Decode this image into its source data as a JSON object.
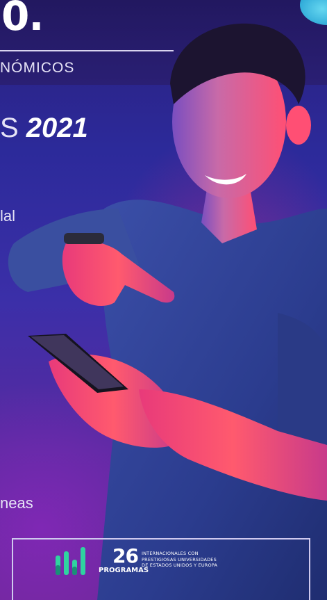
{
  "header": {
    "big_title": "0.",
    "subtitle": "NÓMICOS"
  },
  "headline": {
    "prefix": "S ",
    "year": "2021"
  },
  "fragments": {
    "line_1": "lal",
    "line_2": "neas"
  },
  "programs_badge": {
    "number": "26",
    "label": "PROGRAMAS",
    "description_lines": [
      "INTERNACIONALES CON",
      "PRESTIGIOSAS UNIVERSIDADES",
      "DE ESTADOS UNIDOS Y EUROPA"
    ],
    "icon": "bar-chart-icon",
    "icon_color": "#2fd3a0"
  },
  "colors": {
    "background_top": "#2a1f7c",
    "background_bottom": "#6b2898",
    "accent_pink": "#ff2a74",
    "accent_cyan": "#2aa6d6"
  }
}
